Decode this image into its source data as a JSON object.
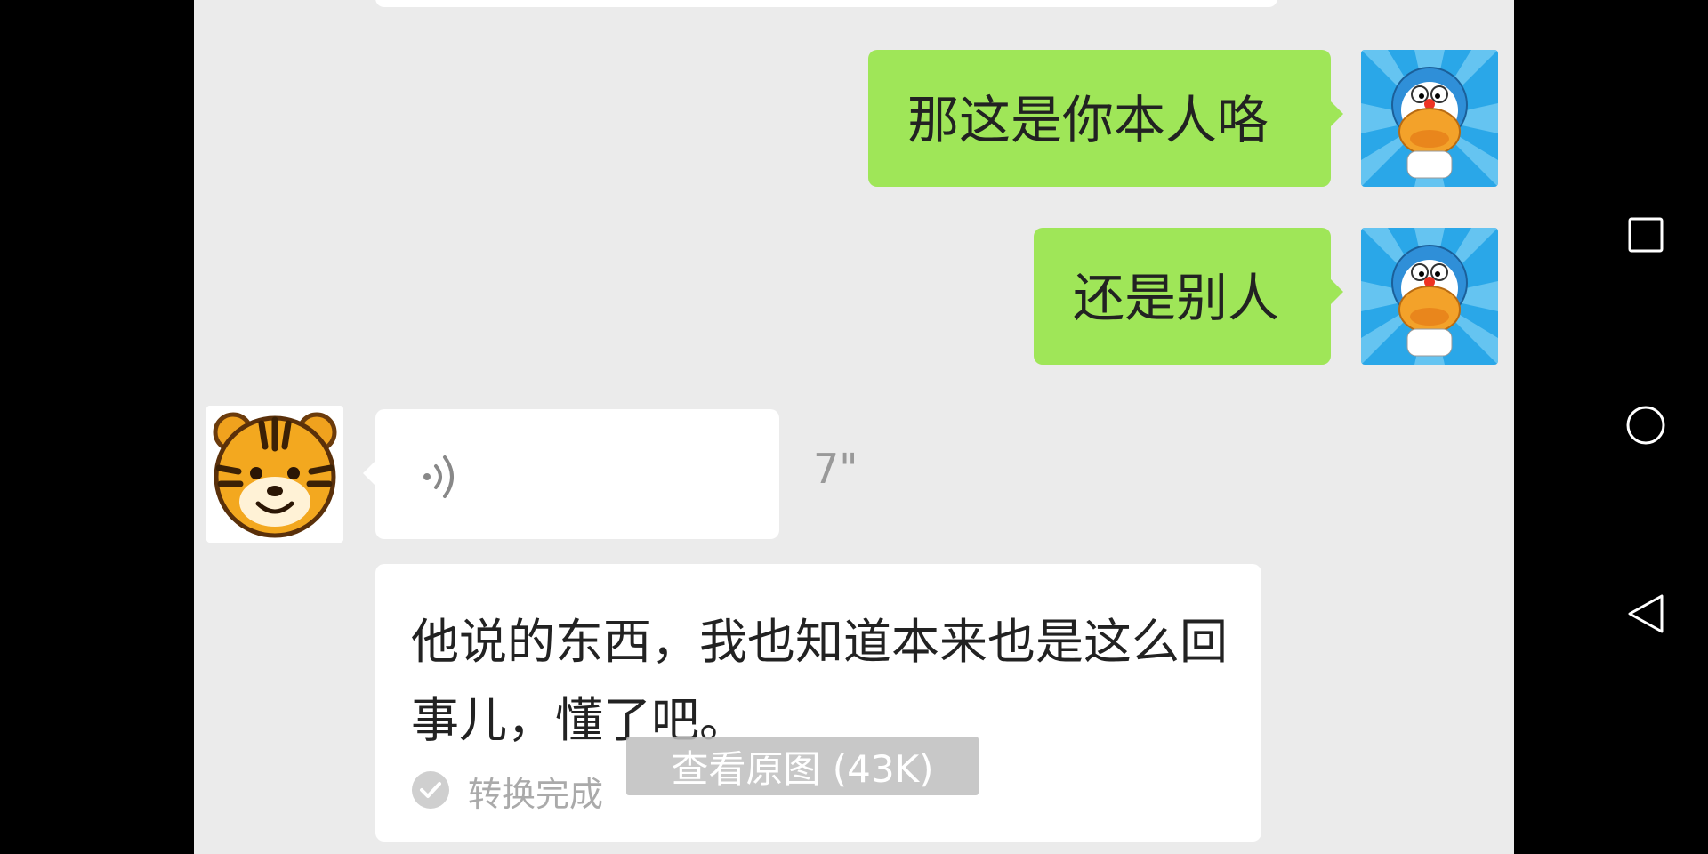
{
  "messages": {
    "sent_1": "那这是你本人咯",
    "sent_2": "还是别人",
    "voice_duration": "7\"",
    "transcript": "他说的东西，我也知道本来也是这么回事儿，懂了吧。",
    "transcript_status": "转换完成"
  },
  "overlay": {
    "view_original": "查看原图 (43K)"
  },
  "avatars": {
    "self": "doraemon-avatar",
    "contact": "tiger-avatar"
  },
  "colors": {
    "sent_bubble": "#9fe658",
    "received_bubble": "#ffffff",
    "chat_background": "#ebebeb"
  },
  "nav": {
    "icons": [
      "recent-apps-icon",
      "home-icon",
      "back-icon"
    ]
  }
}
